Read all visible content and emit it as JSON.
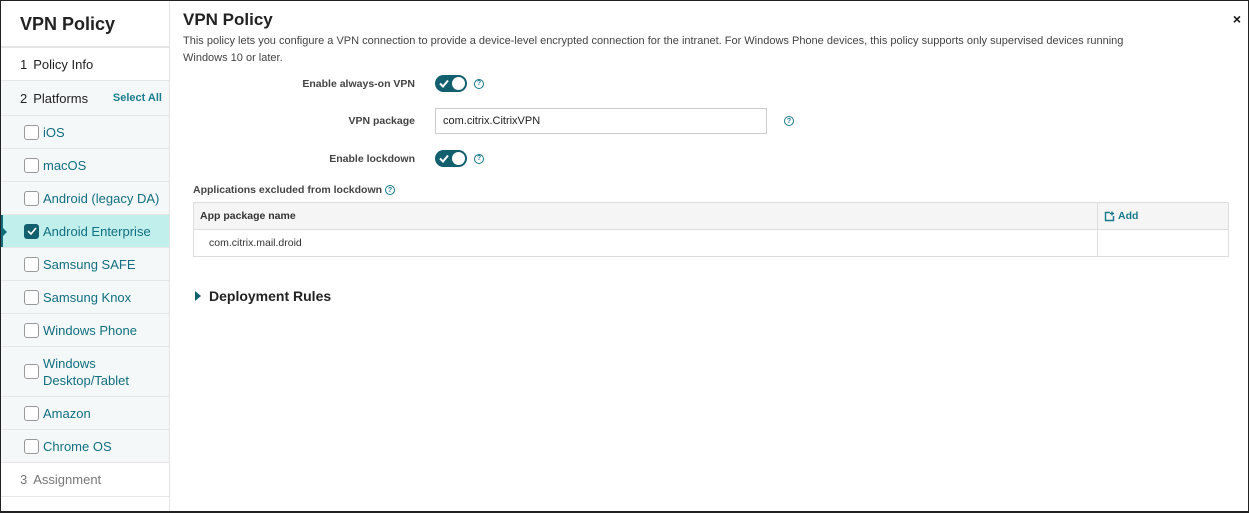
{
  "sidebar": {
    "title": "VPN Policy",
    "steps": [
      {
        "num": "1",
        "label": "Policy Info"
      },
      {
        "num": "2",
        "label": "Platforms",
        "action": "Select All"
      },
      {
        "num": "3",
        "label": "Assignment"
      }
    ],
    "platforms": [
      {
        "label": "iOS",
        "checked": false
      },
      {
        "label": "macOS",
        "checked": false
      },
      {
        "label": "Android (legacy DA)",
        "checked": false
      },
      {
        "label": "Android Enterprise",
        "checked": true,
        "active": true
      },
      {
        "label": "Samsung SAFE",
        "checked": false
      },
      {
        "label": "Samsung Knox",
        "checked": false
      },
      {
        "label": "Windows Phone",
        "checked": false
      },
      {
        "label": "Windows Desktop/Tablet",
        "line1": "Windows",
        "line2": "Desktop/Tablet",
        "checked": false
      },
      {
        "label": "Amazon",
        "checked": false
      },
      {
        "label": "Chrome OS",
        "checked": false
      }
    ]
  },
  "main": {
    "title": "VPN Policy",
    "close_icon": "×",
    "description": "This policy lets you configure a VPN connection to provide a device-level encrypted connection for the intranet. For Windows Phone devices, this policy supports only supervised devices running Windows 10 or later.",
    "fields": {
      "always_on": {
        "label": "Enable always-on VPN",
        "value": true
      },
      "vpn_package": {
        "label": "VPN package",
        "value": "com.citrix.CitrixVPN"
      },
      "lockdown": {
        "label": "Enable lockdown",
        "value": true
      }
    },
    "help_glyph": "?",
    "excluded": {
      "label": "Applications excluded from lockdown",
      "columns": [
        "App package name"
      ],
      "add_label": "Add",
      "rows": [
        "com.citrix.mail.droid"
      ]
    },
    "deployment_rules": "Deployment Rules"
  },
  "colors": {
    "accent": "#125f6e",
    "link": "#16798a",
    "active_bg": "#c1efec"
  }
}
